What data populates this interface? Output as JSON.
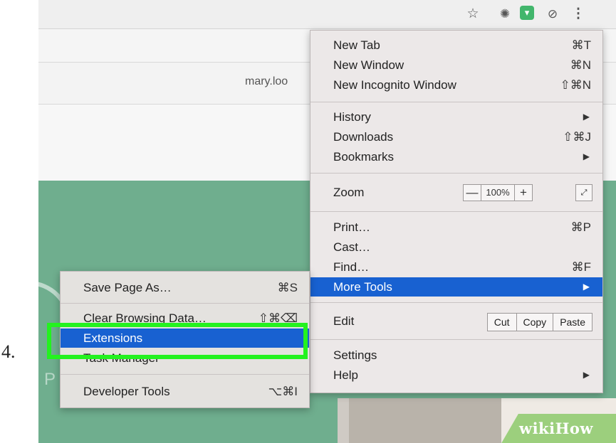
{
  "step_number": "4.",
  "toolbar": {
    "icons": [
      "star-icon",
      "extension-ghostery-icon",
      "extension-green-icon",
      "no-entry-icon",
      "kebab-menu-icon"
    ]
  },
  "user_email": "mary.loo",
  "watermark": "wikiHow",
  "main_menu": {
    "new_tab": {
      "label": "New Tab",
      "shortcut": "⌘T"
    },
    "new_window": {
      "label": "New Window",
      "shortcut": "⌘N"
    },
    "new_incognito": {
      "label": "New Incognito Window",
      "shortcut": "⇧⌘N"
    },
    "history": {
      "label": "History"
    },
    "downloads": {
      "label": "Downloads",
      "shortcut": "⇧⌘J"
    },
    "bookmarks": {
      "label": "Bookmarks"
    },
    "zoom": {
      "label": "Zoom",
      "minus": "—",
      "value": "100%",
      "plus": "+",
      "fullscreen": "⤢"
    },
    "print": {
      "label": "Print…",
      "shortcut": "⌘P"
    },
    "cast": {
      "label": "Cast…"
    },
    "find": {
      "label": "Find…",
      "shortcut": "⌘F"
    },
    "more_tools": {
      "label": "More Tools"
    },
    "edit": {
      "label": "Edit",
      "cut": "Cut",
      "copy": "Copy",
      "paste": "Paste"
    },
    "settings": {
      "label": "Settings"
    },
    "help": {
      "label": "Help"
    }
  },
  "sub_menu": {
    "save_page": {
      "label": "Save Page As…",
      "shortcut": "⌘S"
    },
    "clear_data": {
      "label": "Clear Browsing Data…",
      "shortcut": "⇧⌘⌫"
    },
    "extensions": {
      "label": "Extensions"
    },
    "task_manager": {
      "label": "Task Manager"
    },
    "developer_tools": {
      "label": "Developer Tools",
      "shortcut": "⌥⌘I"
    }
  },
  "colors": {
    "selection": "#1861d1",
    "highlight_box": "#23f21f",
    "page_green": "#6fae8e"
  }
}
